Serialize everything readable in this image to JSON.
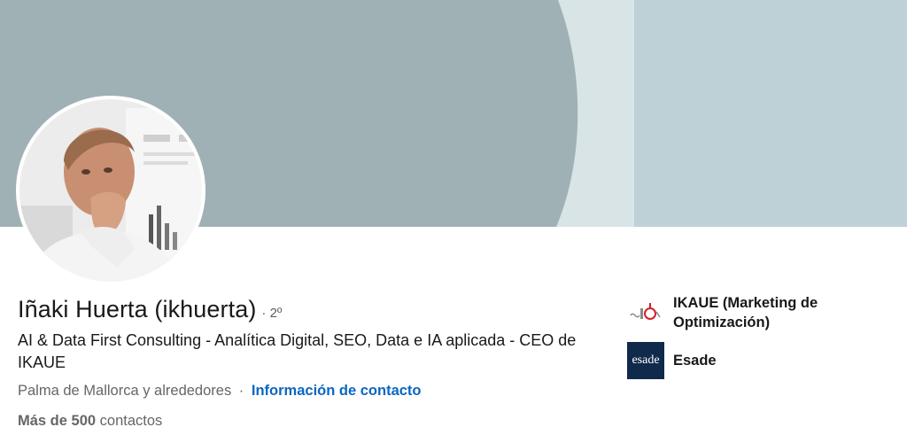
{
  "profile": {
    "name": "Iñaki Huerta (ikhuerta)",
    "degree": "· 2º",
    "headline": "AI & Data First Consulting - Analítica Digital, SEO, Data e IA aplicada - CEO de IKAUE",
    "location": "Palma de Mallorca y alrededores",
    "location_separator": "·",
    "contact_info_label": "Información de contacto",
    "connections_count": "Más de 500",
    "connections_label": "contactos"
  },
  "organizations": [
    {
      "name": "IKAUE (Marketing de Optimización)",
      "logo_icon": "ikaue-logo-icon"
    },
    {
      "name": "Esade",
      "logo_text": "esade",
      "logo_icon": "esade-logo-icon"
    }
  ],
  "colors": {
    "banner_left": "#9fb1b4",
    "banner_mid": "#d8e4e6",
    "banner_right": "#bed1d6",
    "link": "#0a66c2",
    "esade_navy": "#0f2a4a"
  }
}
